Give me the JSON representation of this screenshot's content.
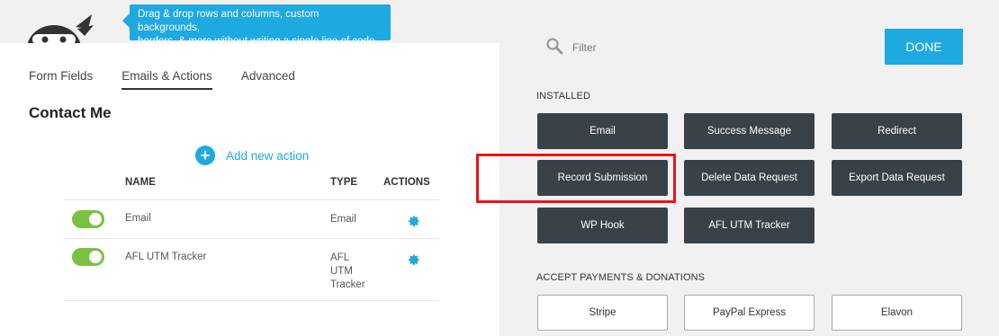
{
  "tooltip": {
    "line1": "Drag & drop rows and columns, custom backgrounds,",
    "line2": "borders, & more without writing a single line of code."
  },
  "tabs": [
    "Form Fields",
    "Emails & Actions",
    "Advanced"
  ],
  "active_tab": "Emails & Actions",
  "form_title": "Contact Me",
  "add_action_label": "Add new action",
  "table": {
    "headers": {
      "name": "NAME",
      "type": "TYPE",
      "actions": "ACTIONS"
    },
    "rows": [
      {
        "name": "Email",
        "type": "Email",
        "enabled": true
      },
      {
        "name": "AFL UTM Tracker",
        "type_lines": [
          "AFL",
          "UTM",
          "Tracker"
        ],
        "enabled": true
      }
    ]
  },
  "filter_placeholder": "Filter",
  "done_label": "DONE",
  "installed": {
    "label": "INSTALLED",
    "buttons": [
      "Email",
      "Success Message",
      "Redirect",
      "Record Submission",
      "Delete Data Request",
      "Export Data Request",
      "WP Hook",
      "AFL UTM Tracker"
    ]
  },
  "payments": {
    "label": "ACCEPT PAYMENTS & DONATIONS",
    "buttons": [
      "Stripe",
      "PayPal Express",
      "Elavon"
    ]
  },
  "colors": {
    "accent": "#1ea9e1",
    "dark_button": "#394249",
    "toggle_on": "#7ac142",
    "highlight": "#e8141c"
  },
  "icons": [
    "ninja-logo-icon",
    "plus-circle-icon",
    "gear-icon",
    "search-icon"
  ]
}
